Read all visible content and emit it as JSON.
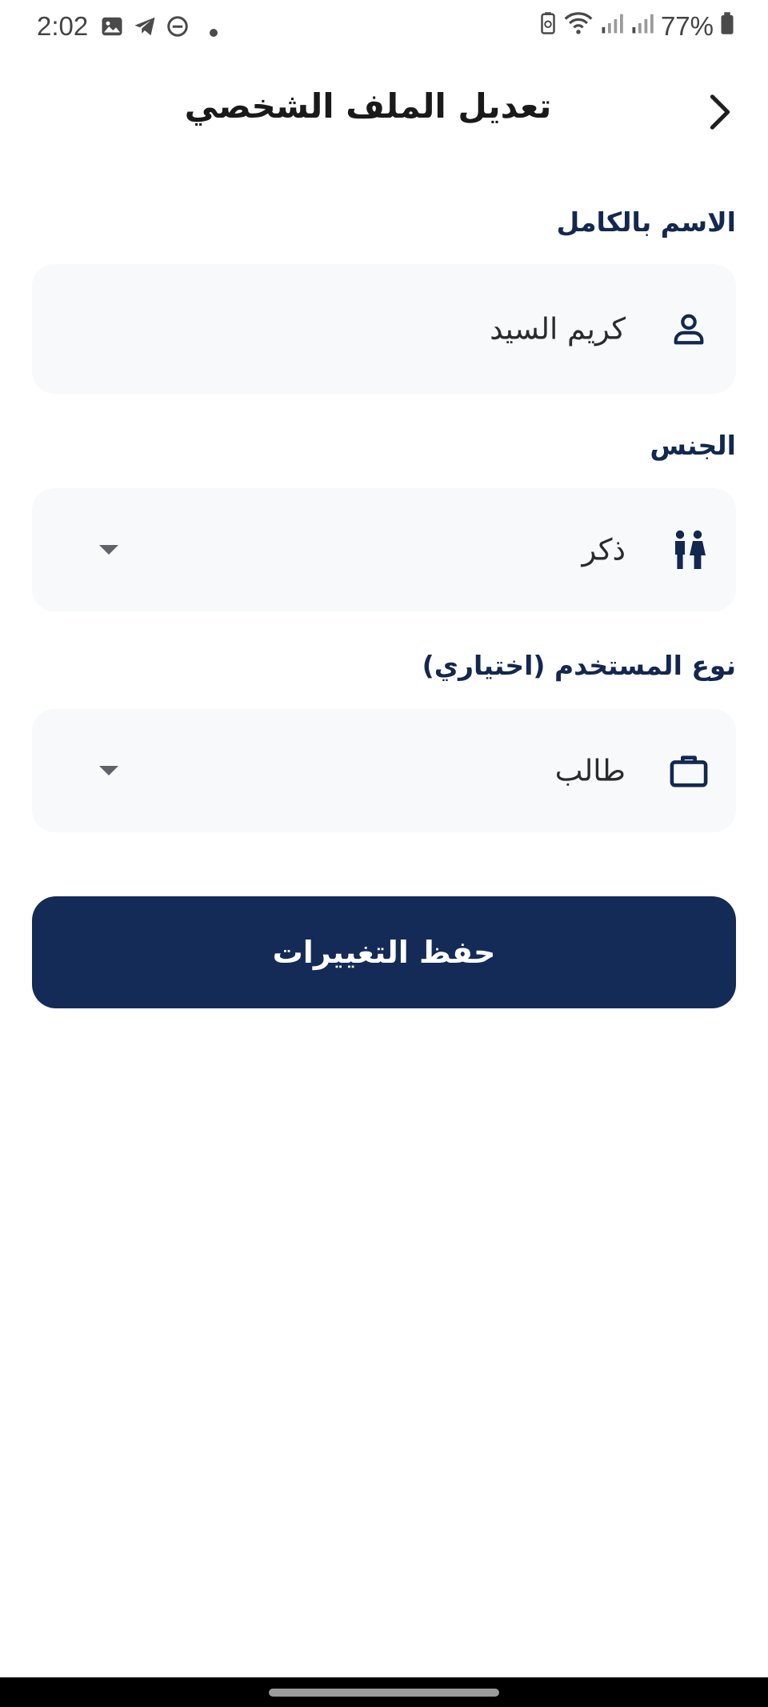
{
  "status_bar": {
    "time": "2:02",
    "battery": "77%",
    "left_icons": [
      "image-icon",
      "telegram-icon",
      "dnd-icon",
      "dot-icon"
    ],
    "right_icons": [
      "battery-saver-icon",
      "wifi-icon",
      "signal-icon",
      "signal-icon",
      "battery-icon"
    ]
  },
  "header": {
    "title": "تعديل الملف الشخصي",
    "back_icon": "chevron-right-icon"
  },
  "form": {
    "full_name": {
      "label": "الاسم بالكامل",
      "value": "كريم السيد",
      "icon": "person-icon"
    },
    "gender": {
      "label": "الجنس",
      "value": "ذكر",
      "icon": "people-icon"
    },
    "user_type": {
      "label": "نوع المستخدم (اختياري)",
      "value": "طالب",
      "icon": "briefcase-icon"
    }
  },
  "save_button": {
    "label": "حفظ التغييرات"
  },
  "colors": {
    "primary": "#142b57",
    "label": "#13284f",
    "field_bg": "#f7f9fb"
  }
}
